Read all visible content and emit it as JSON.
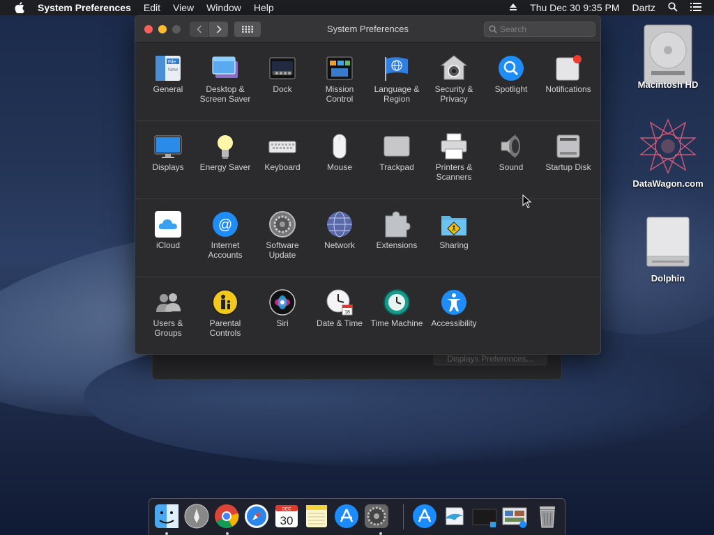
{
  "menubar": {
    "app_name": "System Preferences",
    "items": [
      "Edit",
      "View",
      "Window",
      "Help"
    ],
    "datetime": "Thu Dec 30  9:35 PM",
    "user": "Dartz"
  },
  "window": {
    "title": "System Preferences",
    "search_placeholder": "Search"
  },
  "panes": [
    {
      "label": "General"
    },
    {
      "label": "Desktop & Screen Saver"
    },
    {
      "label": "Dock"
    },
    {
      "label": "Mission Control"
    },
    {
      "label": "Language & Region"
    },
    {
      "label": "Security & Privacy"
    },
    {
      "label": "Spotlight"
    },
    {
      "label": "Notifications"
    },
    {
      "label": "Displays"
    },
    {
      "label": "Energy Saver"
    },
    {
      "label": "Keyboard"
    },
    {
      "label": "Mouse"
    },
    {
      "label": "Trackpad"
    },
    {
      "label": "Printers & Scanners"
    },
    {
      "label": "Sound"
    },
    {
      "label": "Startup Disk"
    },
    {
      "label": "iCloud"
    },
    {
      "label": "Internet Accounts"
    },
    {
      "label": "Software Update"
    },
    {
      "label": "Network"
    },
    {
      "label": "Extensions"
    },
    {
      "label": "Sharing"
    },
    {
      "label": "Users & Groups"
    },
    {
      "label": "Parental Controls"
    },
    {
      "label": "Siri"
    },
    {
      "label": "Date & Time"
    },
    {
      "label": "Time Machine"
    },
    {
      "label": "Accessibility"
    }
  ],
  "background_window": {
    "button_label": "Displays Preferences..."
  },
  "desktop": {
    "icons": [
      {
        "label": "Macintosh HD"
      },
      {
        "label": "DataWagon.com"
      },
      {
        "label": "Dolphin"
      }
    ]
  },
  "dock": {
    "calendar_month": "DEC",
    "calendar_day": "30",
    "items": [
      "finder-icon",
      "launchpad-icon",
      "chrome-icon",
      "safari-icon",
      "calendar-icon",
      "notes-icon",
      "app-store-icon",
      "system-preferences-icon",
      "applications-folder-icon",
      "dolphin-icon",
      "screenshot-icon",
      "preview-icon",
      "trash-icon"
    ]
  },
  "colors": {
    "accent_blue": "#1a8cff",
    "close": "#fc5f57",
    "minimize": "#fdbc2e",
    "window_bg": "#2b2b2d"
  }
}
